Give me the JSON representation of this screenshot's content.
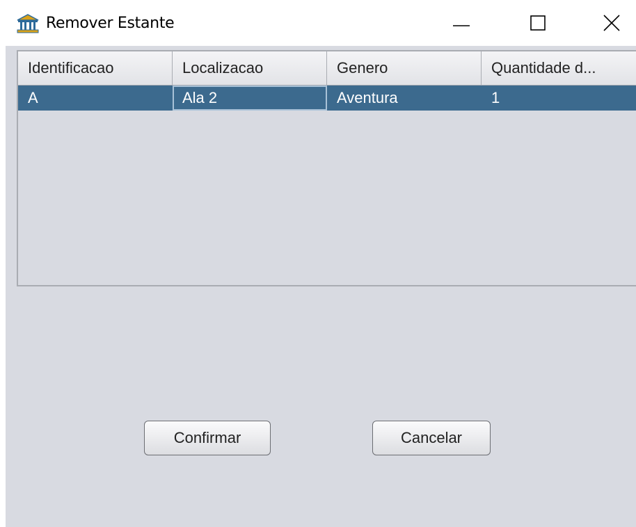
{
  "window": {
    "title": "Remover Estante",
    "icon": "bank-icon"
  },
  "table": {
    "columns": [
      "Identificacao",
      "Localizacao",
      "Genero",
      "Quantidade d..."
    ],
    "rows": [
      [
        "A",
        "Ala 2",
        "Aventura",
        "1"
      ]
    ]
  },
  "buttons": {
    "confirm_label": "Confirmar",
    "cancel_label": "Cancelar"
  },
  "colors": {
    "selection": "#3c6a8e",
    "panel": "#d8dae1"
  }
}
